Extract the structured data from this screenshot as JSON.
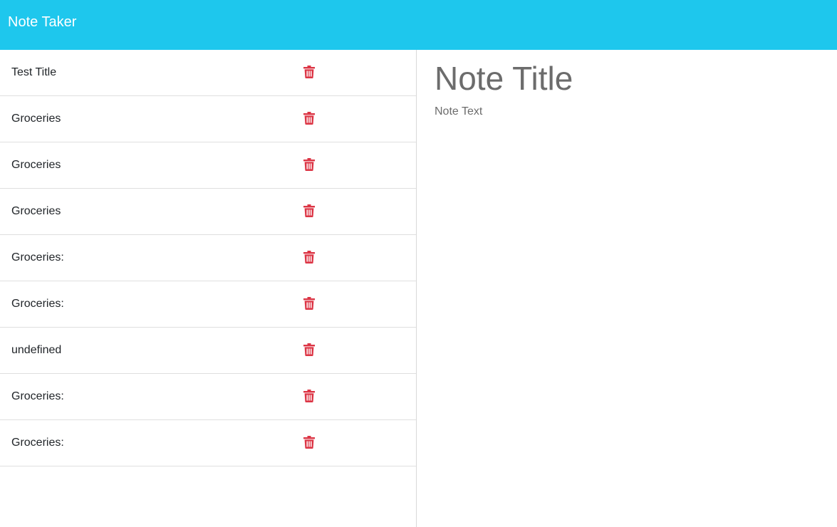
{
  "app": {
    "brand": "Note Taker"
  },
  "colors": {
    "navbar": "#1ec7ed",
    "delete_icon": "#dc3545"
  },
  "notes": [
    {
      "title": "Test Title",
      "icon": "trash-icon"
    },
    {
      "title": "Groceries",
      "icon": "trash-icon"
    },
    {
      "title": "Groceries",
      "icon": "trash-icon"
    },
    {
      "title": "Groceries",
      "icon": "trash-icon"
    },
    {
      "title": "Groceries:",
      "icon": "trash-icon"
    },
    {
      "title": "Groceries:",
      "icon": "trash-icon"
    },
    {
      "title": "undefined",
      "icon": "trash-icon"
    },
    {
      "title": "Groceries:",
      "icon": "trash-icon"
    },
    {
      "title": "Groceries:",
      "icon": "trash-icon"
    }
  ],
  "editor": {
    "title_placeholder": "Note Title",
    "title_value": "",
    "text_placeholder": "Note Text",
    "text_value": ""
  }
}
